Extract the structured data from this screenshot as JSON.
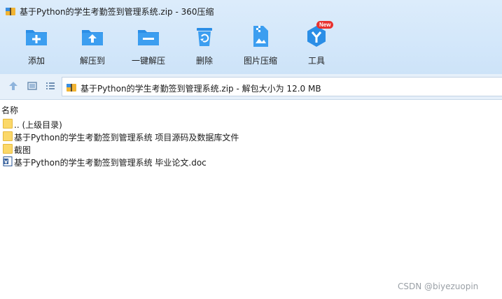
{
  "window": {
    "title": "基于Python的学生考勤签到管理系统.zip - 360压缩"
  },
  "toolbar": {
    "items": [
      {
        "label": "添加",
        "icon": "add-icon"
      },
      {
        "label": "解压到",
        "icon": "extract-to-icon"
      },
      {
        "label": "一键解压",
        "icon": "one-click-extract-icon"
      },
      {
        "label": "删除",
        "icon": "delete-icon"
      },
      {
        "label": "图片压缩",
        "icon": "image-compress-icon"
      },
      {
        "label": "工具",
        "icon": "tools-icon",
        "badge": "New"
      }
    ],
    "accent_color": "#2b8ee6",
    "badge_color": "#e8322f"
  },
  "address": {
    "path": "基于Python的学生考勤签到管理系统.zip - 解包大小为 12.0 MB"
  },
  "list": {
    "column_name": "名称",
    "rows": [
      {
        "name": ".. (上级目录)",
        "type": "folder"
      },
      {
        "name": "基于Python的学生考勤签到管理系统 项目源码及数据库文件",
        "type": "folder"
      },
      {
        "name": "截图",
        "type": "folder"
      },
      {
        "name": "基于Python的学生考勤签到管理系统 毕业论文.doc",
        "type": "doc"
      }
    ]
  },
  "watermark": "CSDN @biyezuopin"
}
